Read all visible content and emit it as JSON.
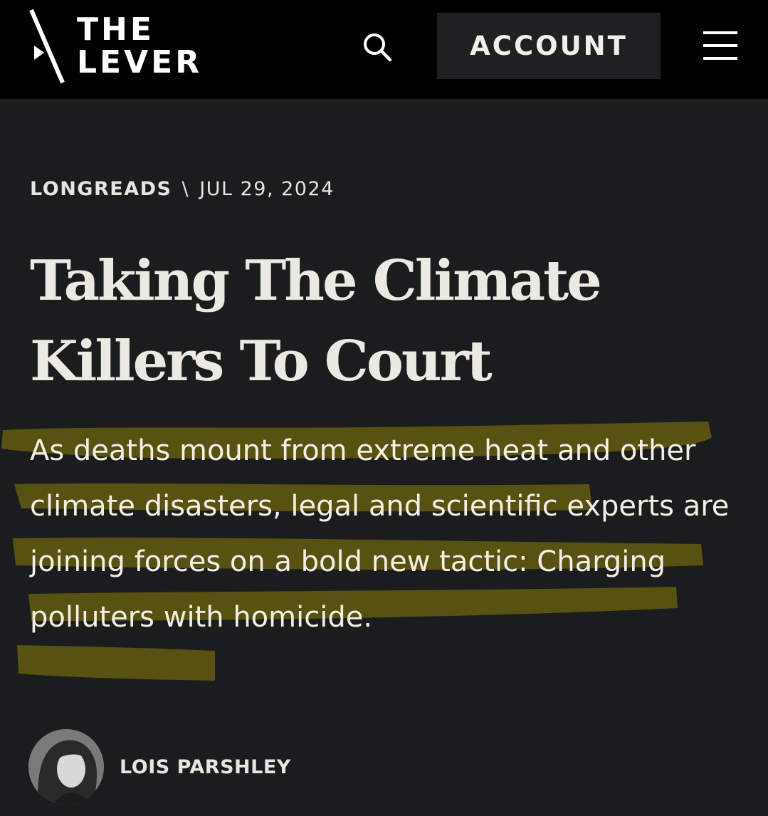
{
  "header": {
    "logo": {
      "line1": "THE",
      "line2": "LEVER"
    },
    "search_icon": "search-icon",
    "account_label": "ACCOUNT",
    "menu_icon": "hamburger-menu-icon"
  },
  "article": {
    "category": "LONGREADS",
    "separator": "\\",
    "date": "JUL 29, 2024",
    "headline": "Taking The Climate Killers To Court",
    "dek": "As deaths mount from extreme heat and other climate disasters, legal and scientific experts are joining forces on a bold new tactic: Charging polluters with homicide.",
    "author": "LOIS PARSHLEY"
  },
  "colors": {
    "background": "#1b1c1e",
    "header_background": "#000000",
    "account_button": "#1f2022",
    "highlight": "#5b5412",
    "text": "#ece9e3"
  }
}
